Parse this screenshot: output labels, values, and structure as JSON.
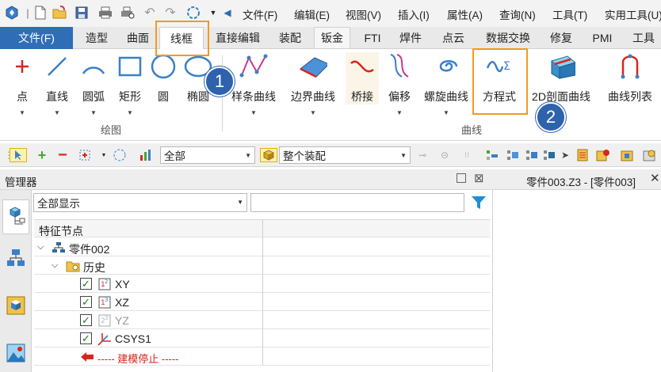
{
  "menu": [
    "文件(F)",
    "编辑(E)",
    "视图(V)",
    "插入(I)",
    "属性(A)",
    "查询(N)",
    "工具(T)",
    "实用工具(U)"
  ],
  "tabs": {
    "file": "文件(F)",
    "items": [
      "造型",
      "曲面",
      "线框",
      "直接编辑",
      "装配",
      "钣金",
      "FTI",
      "焊件",
      "点云",
      "数据交换",
      "修复",
      "PMI",
      "工具"
    ]
  },
  "ribbon": {
    "draw_group": "绘图",
    "curve_group": "曲线",
    "buttons": [
      "点",
      "直线",
      "圆弧",
      "矩形",
      "圆",
      "椭圆",
      "样条曲线",
      "边界曲线",
      "桥接",
      "偏移",
      "螺旋曲线",
      "方程式",
      "2D剖面曲线",
      "曲线列表"
    ]
  },
  "badges": [
    "1",
    "2"
  ],
  "filter": {
    "scope": "全部",
    "assembly": "整个装配"
  },
  "manager": {
    "title": "管理器",
    "doc_title": "零件003.Z3 - [零件003]",
    "display_filter": "全部显示",
    "search_value": "",
    "column_header": "特征节点",
    "tree": {
      "root": "零件002",
      "history": "历史",
      "planes": [
        "XY",
        "XZ",
        "YZ"
      ],
      "csys": "CSYS1",
      "stop": "----- 建模停止 -----"
    }
  },
  "colors": {
    "accent": "#2f6db6",
    "highlight": "#f39a1f",
    "badge": "#2e62ad",
    "stop": "#d9261c"
  }
}
